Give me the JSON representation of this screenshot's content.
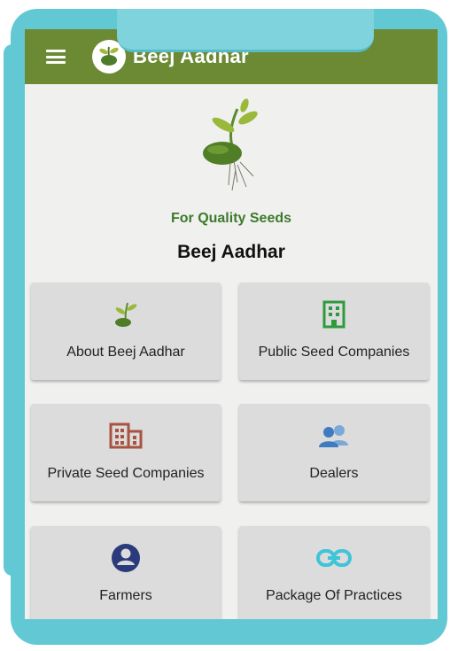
{
  "app": {
    "title": "Beej Aadhar",
    "menu_icon": "hamburger-menu-icon",
    "logo_icon": "seedling-logo-icon"
  },
  "hero": {
    "tagline": "For Quality Seeds",
    "brand": "Beej Aadhar",
    "logo_icon": "seedling-logo-icon"
  },
  "tiles": [
    {
      "label": "About Beej Aadhar",
      "icon": "seedling-icon",
      "color": "#6b8a33"
    },
    {
      "label": "Public Seed Companies",
      "icon": "office-building-icon",
      "color": "#2e9a3c"
    },
    {
      "label": "Private Seed Companies",
      "icon": "company-buildings-icon",
      "color": "#a9523f"
    },
    {
      "label": "Dealers",
      "icon": "people-group-icon",
      "color": "#4a86c7"
    },
    {
      "label": "Farmers",
      "icon": "user-circle-icon",
      "color": "#2a3a7a"
    },
    {
      "label": "Package Of Practices",
      "icon": "link-icon",
      "color": "#3fc4d8"
    }
  ],
  "colors": {
    "appbar": "#6b8a33",
    "tagline": "#3d7a2a",
    "frame": "#62c9d4"
  }
}
